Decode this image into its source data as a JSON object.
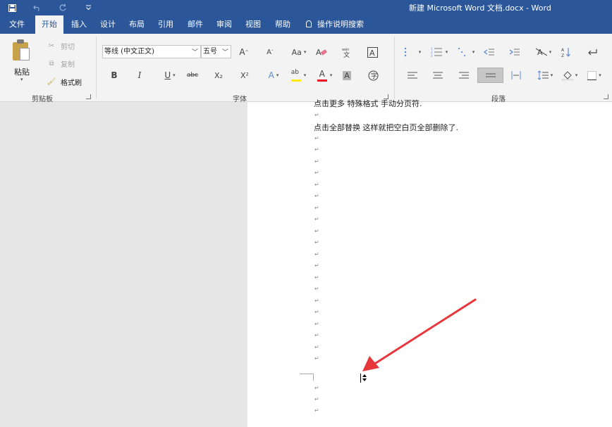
{
  "window": {
    "title": "新建 Microsoft Word 文档.docx  -  Word"
  },
  "qat": {
    "save_icon": "save-icon",
    "undo_icon": "undo-icon",
    "redo_icon": "redo-icon",
    "customize_icon": "customize-qat-icon"
  },
  "tabs": [
    {
      "label": "文件"
    },
    {
      "label": "开始"
    },
    {
      "label": "插入"
    },
    {
      "label": "设计"
    },
    {
      "label": "布局"
    },
    {
      "label": "引用"
    },
    {
      "label": "邮件"
    },
    {
      "label": "审阅"
    },
    {
      "label": "视图"
    },
    {
      "label": "帮助"
    },
    {
      "label": "操作说明搜索"
    }
  ],
  "clipboard": {
    "paste": "粘贴",
    "cut": "剪切",
    "copy": "复制",
    "format_painter": "格式刷",
    "group_label": "剪贴板"
  },
  "font": {
    "font_name": "等线 (中文正文)",
    "font_size": "五号",
    "grow": "A",
    "shrink": "A",
    "change_case": "Aa",
    "bold": "B",
    "italic": "I",
    "underline": "U",
    "strike": "abc",
    "subscript": "X₂",
    "superscript": "X²",
    "text_effects": "A",
    "font_color": "A",
    "char_shading": "A",
    "border_char": "A",
    "group_label": "字体"
  },
  "paragraph": {
    "group_label": "段落"
  },
  "document": {
    "line1": "点击更多 特殊格式 手动分页符.",
    "line2": "点击全部替换 这样就把空白页全部删除了.",
    "pilcrow": "↵"
  },
  "colors": {
    "accent": "#2b579a",
    "arrow": "#e8373c"
  }
}
